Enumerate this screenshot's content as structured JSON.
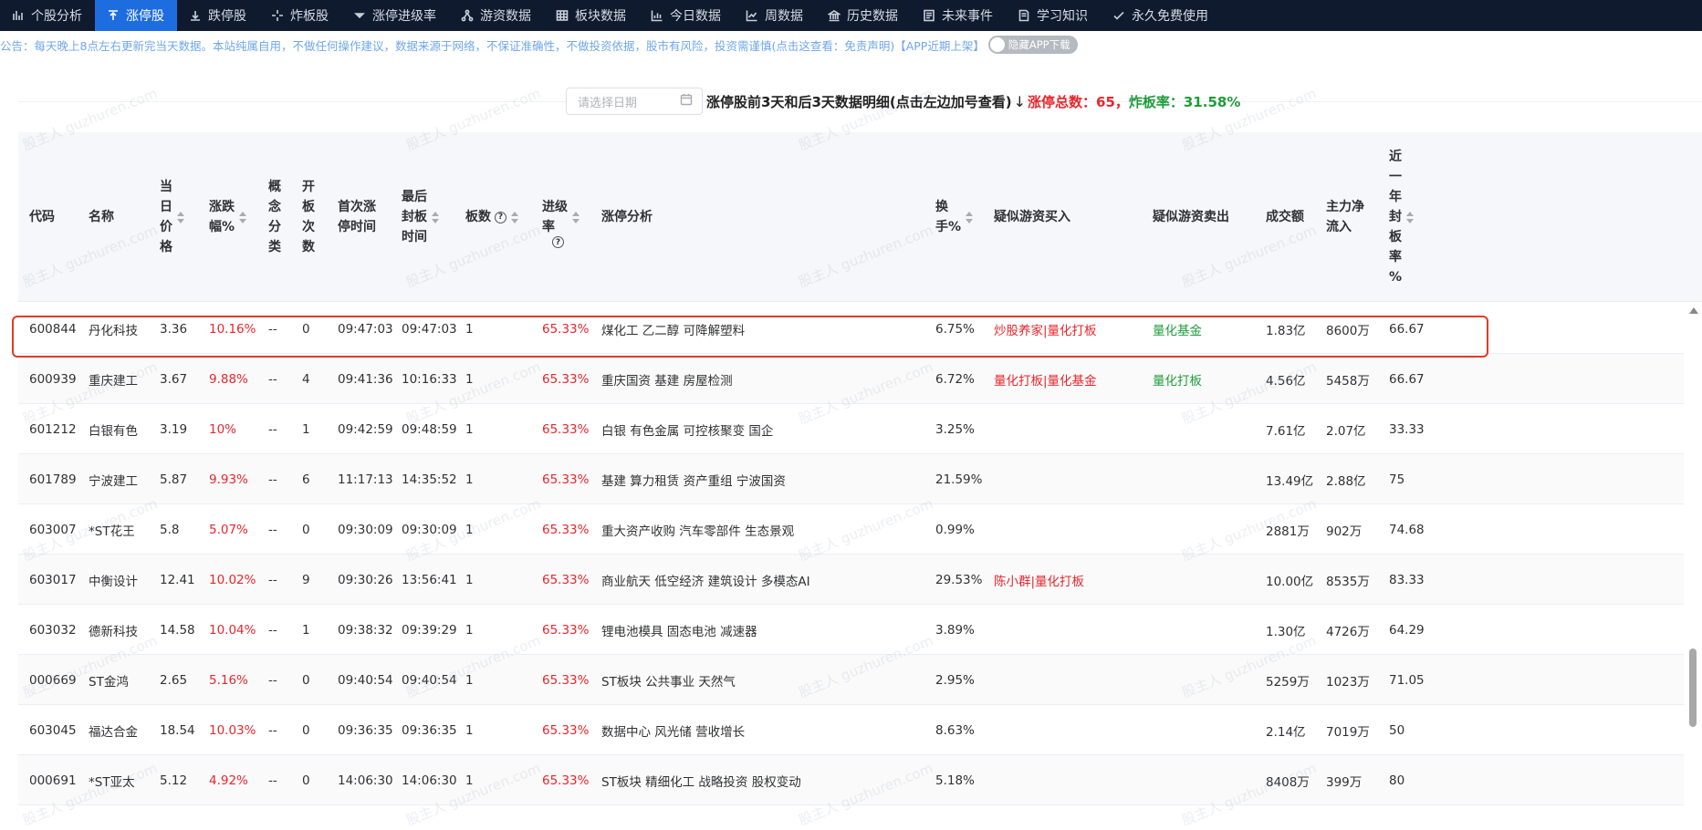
{
  "nav": [
    {
      "label": "个股分析",
      "icon": "stock-analysis-icon",
      "active": false
    },
    {
      "label": "涨停股",
      "icon": "limit-up-icon",
      "active": true
    },
    {
      "label": "跌停股",
      "icon": "limit-down-icon",
      "active": false
    },
    {
      "label": "炸板股",
      "icon": "broken-board-icon",
      "active": false
    },
    {
      "label": "涨停进级率",
      "icon": "caret-down-icon",
      "active": false
    },
    {
      "label": "游资数据",
      "icon": "network-icon",
      "active": false
    },
    {
      "label": "板块数据",
      "icon": "grid-icon",
      "active": false
    },
    {
      "label": "今日数据",
      "icon": "bar-chart-icon",
      "active": false
    },
    {
      "label": "周数据",
      "icon": "line-chart-icon",
      "active": false
    },
    {
      "label": "历史数据",
      "icon": "bank-icon",
      "active": false
    },
    {
      "label": "未来事件",
      "icon": "calendar-list-icon",
      "active": false
    },
    {
      "label": "学习知识",
      "icon": "book-icon",
      "active": false
    },
    {
      "label": "永久免费使用",
      "icon": "check-icon",
      "active": false
    }
  ],
  "notice": {
    "text": "公告：每天晚上8点左右更新完当天数据。本站纯属自用，不做任何操作建议，数据来源于网络，不保证准确性，不做投资依据，股市有风险，投资需谨慎(点击这查看：免责声明)【APP近期上架】",
    "toggle_label": "隐藏APP下载"
  },
  "toolbar": {
    "date_placeholder": "请选择日期",
    "title": "涨停股前3天和后3天数据明细(点击左边加号查看)",
    "arrow": "↓",
    "total_label": "涨停总数：65，",
    "break_rate_label": "炸板率：31.58%"
  },
  "columns": [
    {
      "key": "code",
      "label": "代码"
    },
    {
      "key": "name",
      "label": "名称"
    },
    {
      "key": "price",
      "label": "当\n日\n价\n格",
      "sortable": true
    },
    {
      "key": "chg",
      "label": "涨跌\n幅%",
      "sortable": true
    },
    {
      "key": "concept",
      "label": "概\n念\n分\n类"
    },
    {
      "key": "opens",
      "label": "开\n板\n次\n数"
    },
    {
      "key": "first_time",
      "label": "首次涨\n停时间"
    },
    {
      "key": "last_time",
      "label": "最后\n封板\n时间",
      "sortable": true
    },
    {
      "key": "boards",
      "label": "板数",
      "sortable": true,
      "help": true
    },
    {
      "key": "adv_rate",
      "label": "进级\n率",
      "sortable": true,
      "help": true
    },
    {
      "key": "analysis",
      "label": "涨停分析"
    },
    {
      "key": "turnover",
      "label": "换\n手%",
      "sortable": true
    },
    {
      "key": "buy",
      "label": "疑似游资买入"
    },
    {
      "key": "sell",
      "label": "疑似游资卖出"
    },
    {
      "key": "amount",
      "label": "成交额"
    },
    {
      "key": "net",
      "label": "主力净\n流入"
    },
    {
      "key": "year_rate",
      "label": "近\n一\n年\n封\n板\n率\n%",
      "sortable": true
    }
  ],
  "rows": [
    {
      "code": "600844",
      "name": "丹化科技",
      "price": "3.36",
      "chg": "10.16%",
      "concept": "--",
      "opens": "0",
      "first_time": "09:47:03",
      "last_time": "09:47:03",
      "boards": "1",
      "adv_rate": "65.33%",
      "analysis": "煤化工 乙二醇 可降解塑料",
      "turnover": "6.75%",
      "buy": "炒股养家|量化打板",
      "sell": "量化基金",
      "amount": "1.83亿",
      "net": "8600万",
      "year_rate": "66.67"
    },
    {
      "code": "600939",
      "name": "重庆建工",
      "price": "3.67",
      "chg": "9.88%",
      "concept": "--",
      "opens": "4",
      "first_time": "09:41:36",
      "last_time": "10:16:33",
      "boards": "1",
      "adv_rate": "65.33%",
      "analysis": "重庆国资 基建 房屋检测",
      "turnover": "6.72%",
      "buy": "量化打板|量化基金",
      "sell": "量化打板",
      "amount": "4.56亿",
      "net": "5458万",
      "year_rate": "66.67"
    },
    {
      "code": "601212",
      "name": "白银有色",
      "price": "3.19",
      "chg": "10%",
      "concept": "--",
      "opens": "1",
      "first_time": "09:42:59",
      "last_time": "09:48:59",
      "boards": "1",
      "adv_rate": "65.33%",
      "analysis": "白银 有色金属 可控核聚变 国企",
      "turnover": "3.25%",
      "buy": "",
      "sell": "",
      "amount": "7.61亿",
      "net": "2.07亿",
      "year_rate": "33.33"
    },
    {
      "code": "601789",
      "name": "宁波建工",
      "price": "5.87",
      "chg": "9.93%",
      "concept": "--",
      "opens": "6",
      "first_time": "11:17:13",
      "last_time": "14:35:52",
      "boards": "1",
      "adv_rate": "65.33%",
      "analysis": "基建 算力租赁 资产重组 宁波国资",
      "turnover": "21.59%",
      "buy": "",
      "sell": "",
      "amount": "13.49亿",
      "net": "2.88亿",
      "year_rate": "75"
    },
    {
      "code": "603007",
      "name": "*ST花王",
      "price": "5.8",
      "chg": "5.07%",
      "concept": "--",
      "opens": "0",
      "first_time": "09:30:09",
      "last_time": "09:30:09",
      "boards": "1",
      "adv_rate": "65.33%",
      "analysis": "重大资产收购 汽车零部件 生态景观",
      "turnover": "0.99%",
      "buy": "",
      "sell": "",
      "amount": "2881万",
      "net": "902万",
      "year_rate": "74.68"
    },
    {
      "code": "603017",
      "name": "中衡设计",
      "price": "12.41",
      "chg": "10.02%",
      "concept": "--",
      "opens": "9",
      "first_time": "09:30:26",
      "last_time": "13:56:41",
      "boards": "1",
      "adv_rate": "65.33%",
      "analysis": "商业航天 低空经济 建筑设计 多模态AI",
      "turnover": "29.53%",
      "buy": "陈小群|量化打板",
      "sell": "",
      "amount": "10.00亿",
      "net": "8535万",
      "year_rate": "83.33"
    },
    {
      "code": "603032",
      "name": "德新科技",
      "price": "14.58",
      "chg": "10.04%",
      "concept": "--",
      "opens": "1",
      "first_time": "09:38:32",
      "last_time": "09:39:29",
      "boards": "1",
      "adv_rate": "65.33%",
      "analysis": "锂电池模具 固态电池 减速器",
      "turnover": "3.89%",
      "buy": "",
      "sell": "",
      "amount": "1.30亿",
      "net": "4726万",
      "year_rate": "64.29"
    },
    {
      "code": "000669",
      "name": "ST金鸿",
      "price": "2.65",
      "chg": "5.16%",
      "concept": "--",
      "opens": "0",
      "first_time": "09:40:54",
      "last_time": "09:40:54",
      "boards": "1",
      "adv_rate": "65.33%",
      "analysis": "ST板块 公共事业 天然气",
      "turnover": "2.95%",
      "buy": "",
      "sell": "",
      "amount": "5259万",
      "net": "1023万",
      "year_rate": "71.05"
    },
    {
      "code": "603045",
      "name": "福达合金",
      "price": "18.54",
      "chg": "10.03%",
      "concept": "--",
      "opens": "0",
      "first_time": "09:36:35",
      "last_time": "09:36:35",
      "boards": "1",
      "adv_rate": "65.33%",
      "analysis": "数据中心 风光储 营收增长",
      "turnover": "8.63%",
      "buy": "",
      "sell": "",
      "amount": "2.14亿",
      "net": "7019万",
      "year_rate": "50"
    },
    {
      "code": "000691",
      "name": "*ST亚太",
      "price": "5.12",
      "chg": "4.92%",
      "concept": "--",
      "opens": "0",
      "first_time": "14:06:30",
      "last_time": "14:06:30",
      "boards": "1",
      "adv_rate": "65.33%",
      "analysis": "ST板块 精细化工 战略投资 股权变动",
      "turnover": "5.18%",
      "buy": "",
      "sell": "",
      "amount": "8408万",
      "net": "399万",
      "year_rate": "80"
    }
  ],
  "watermark": "股主人 guzhuren.com",
  "colors": {
    "nav_bg": "#0f1a2e",
    "nav_active": "#1e6de0",
    "up_red": "#e8262c",
    "green": "#1f9c3b",
    "notice": "#6fa7e6",
    "highlight": "#e03b2a"
  }
}
